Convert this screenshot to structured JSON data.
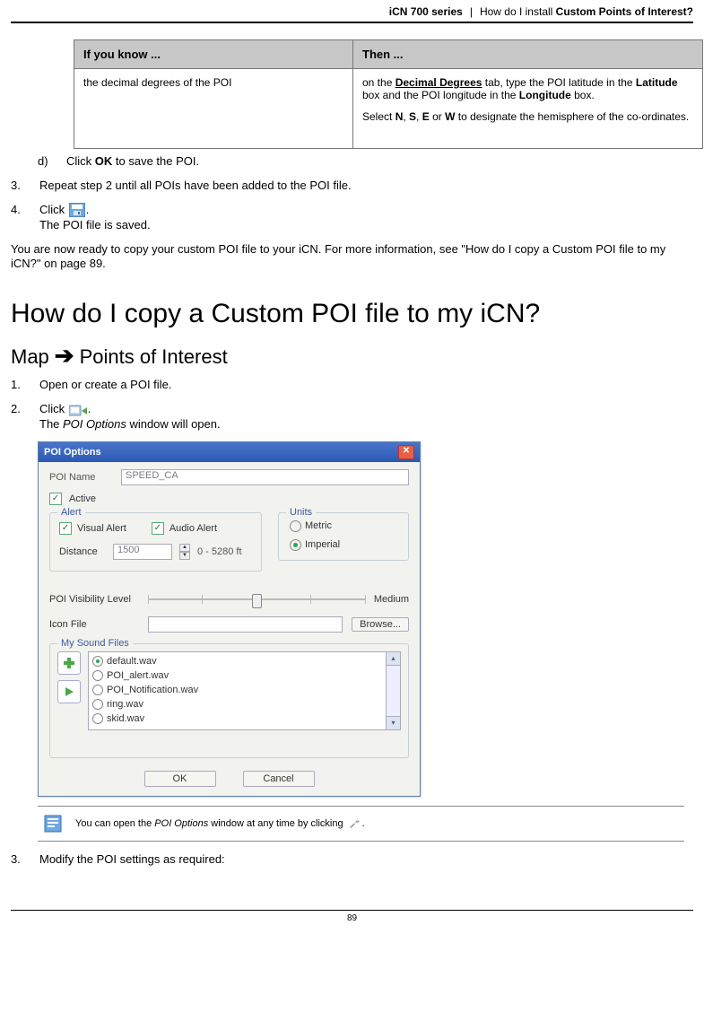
{
  "header": {
    "series": "iCN 700 series",
    "sep": "|",
    "question_prefix": "How do I install ",
    "question_bold": "Custom Points of Interest?"
  },
  "table": {
    "head_if": "If you know ...",
    "head_then": "Then ...",
    "row1_if": "the decimal degrees of the POI",
    "row1_then_p1_a": "on the ",
    "row1_then_p1_b": "Decimal Degrees",
    "row1_then_p1_c": " tab, type the POI latitude in the ",
    "row1_then_p1_d": "Latitude",
    "row1_then_p1_e": " box and the POI longitude in the ",
    "row1_then_p1_f": "Longitude",
    "row1_then_p1_g": " box.",
    "row1_then_p2_a": "Select ",
    "row1_then_p2_b": "N",
    "row1_then_p2_c": ", ",
    "row1_then_p2_d": "S",
    "row1_then_p2_e": ", ",
    "row1_then_p2_f": "E",
    "row1_then_p2_g": " or ",
    "row1_then_p2_h": "W",
    "row1_then_p2_i": " to designate the hemisphere of the co-ordinates."
  },
  "step_d": {
    "marker": "d)",
    "text_a": "Click ",
    "text_b": "OK",
    "text_c": " to save the POI."
  },
  "step3": {
    "marker": "3.",
    "text": "Repeat step 2 until all POIs have been added to the POI file."
  },
  "step4": {
    "marker": "4.",
    "line1_a": "Click ",
    "line1_c": ".",
    "line2": "The POI file is saved."
  },
  "para_after": "You are now ready to copy your custom POI file to your iCN. For more information, see \"How do I copy a Custom POI file to my iCN?\" on page 89.",
  "h1": "How do I copy a Custom POI file to my iCN?",
  "h2_a": "Map",
  "h2_b": "Points of Interest",
  "sec2_step1": {
    "marker": "1.",
    "text": "Open or create a POI file."
  },
  "sec2_step2": {
    "marker": "2.",
    "line1_a": "Click ",
    "line1_c": ".",
    "line2_a": "The ",
    "line2_b": "POI Options",
    "line2_c": " window will open."
  },
  "dialog": {
    "title": "POI Options",
    "poi_name_label": "POI Name",
    "poi_name_value": "SPEED_CA",
    "active_label": "Active",
    "alert_legend": "Alert",
    "visual_alert": "Visual Alert",
    "audio_alert": "Audio Alert",
    "distance_label": "Distance",
    "distance_value": "1500",
    "distance_range": "0 - 5280 ft",
    "units_legend": "Units",
    "metric": "Metric",
    "imperial": "Imperial",
    "poi_vis_label": "POI Visibility Level",
    "poi_vis_value": "Medium",
    "iconfile_label": "Icon File",
    "browse": "Browse...",
    "soundfiles_legend": "My Sound Files",
    "sounds": [
      "default.wav",
      "POI_alert.wav",
      "POI_Notification.wav",
      "ring.wav",
      "skid.wav"
    ],
    "ok": "OK",
    "cancel": "Cancel"
  },
  "note": {
    "a": "You can open the ",
    "b": "POI Options",
    "c": " window at any time by clicking ",
    "d": "."
  },
  "sec2_step3": {
    "marker": "3.",
    "text": "Modify the POI settings as required:"
  },
  "page_number": "89"
}
